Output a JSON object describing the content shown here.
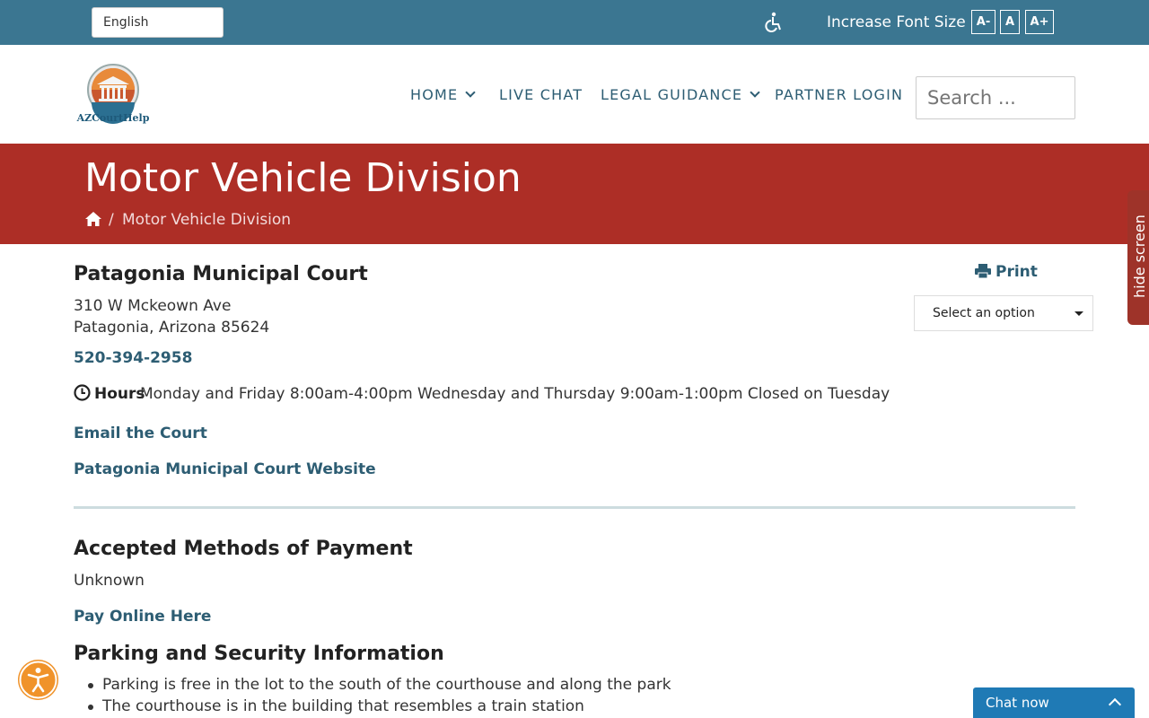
{
  "topbar": {
    "language_selected": "English",
    "font_size_label": "Increase Font Size",
    "font_decrease": "A-",
    "font_normal": "A",
    "font_increase": "A+"
  },
  "header": {
    "logo_text": "AZCourtHelp",
    "nav": {
      "home": "HOME",
      "live_chat": "LIVE CHAT",
      "legal_guidance": "LEGAL GUIDANCE",
      "partner_login": "PARTNER LOGIN"
    },
    "search_placeholder": "Search ..."
  },
  "banner": {
    "title": "Motor Vehicle Division",
    "breadcrumb_separator": "/",
    "breadcrumb_current": "Motor Vehicle Division"
  },
  "side_tab": {
    "label": "hide screen"
  },
  "court": {
    "name": "Patagonia Municipal Court",
    "address_line1": "310 W Mckeown Ave",
    "address_line2": "Patagonia, Arizona 85624",
    "phone": "520-394-2958",
    "hours_label": "Hours",
    "hours_text": "Monday and Friday 8:00am-4:00pm Wednesday and Thursday 9:00am-1:00pm Closed on Tuesday",
    "email_link": "Email the Court",
    "website_link": "Patagonia Municipal Court Website"
  },
  "actions": {
    "print_label": "Print",
    "option_select": "Select an option"
  },
  "payment": {
    "heading": "Accepted Methods of Payment",
    "value": "Unknown",
    "pay_link": "Pay Online Here"
  },
  "parking": {
    "heading": "Parking and Security Information",
    "items": [
      "Parking is free in the lot to the south of the courthouse and along the park",
      "The courthouse is in the building that resembles a train station"
    ]
  },
  "chat": {
    "label": "Chat now"
  },
  "colors": {
    "topbar": "#3b7691",
    "banner": "#ad2e26",
    "link": "#2d5d73",
    "chat": "#1f7ab5",
    "a11y_widget": "#f0932a"
  }
}
